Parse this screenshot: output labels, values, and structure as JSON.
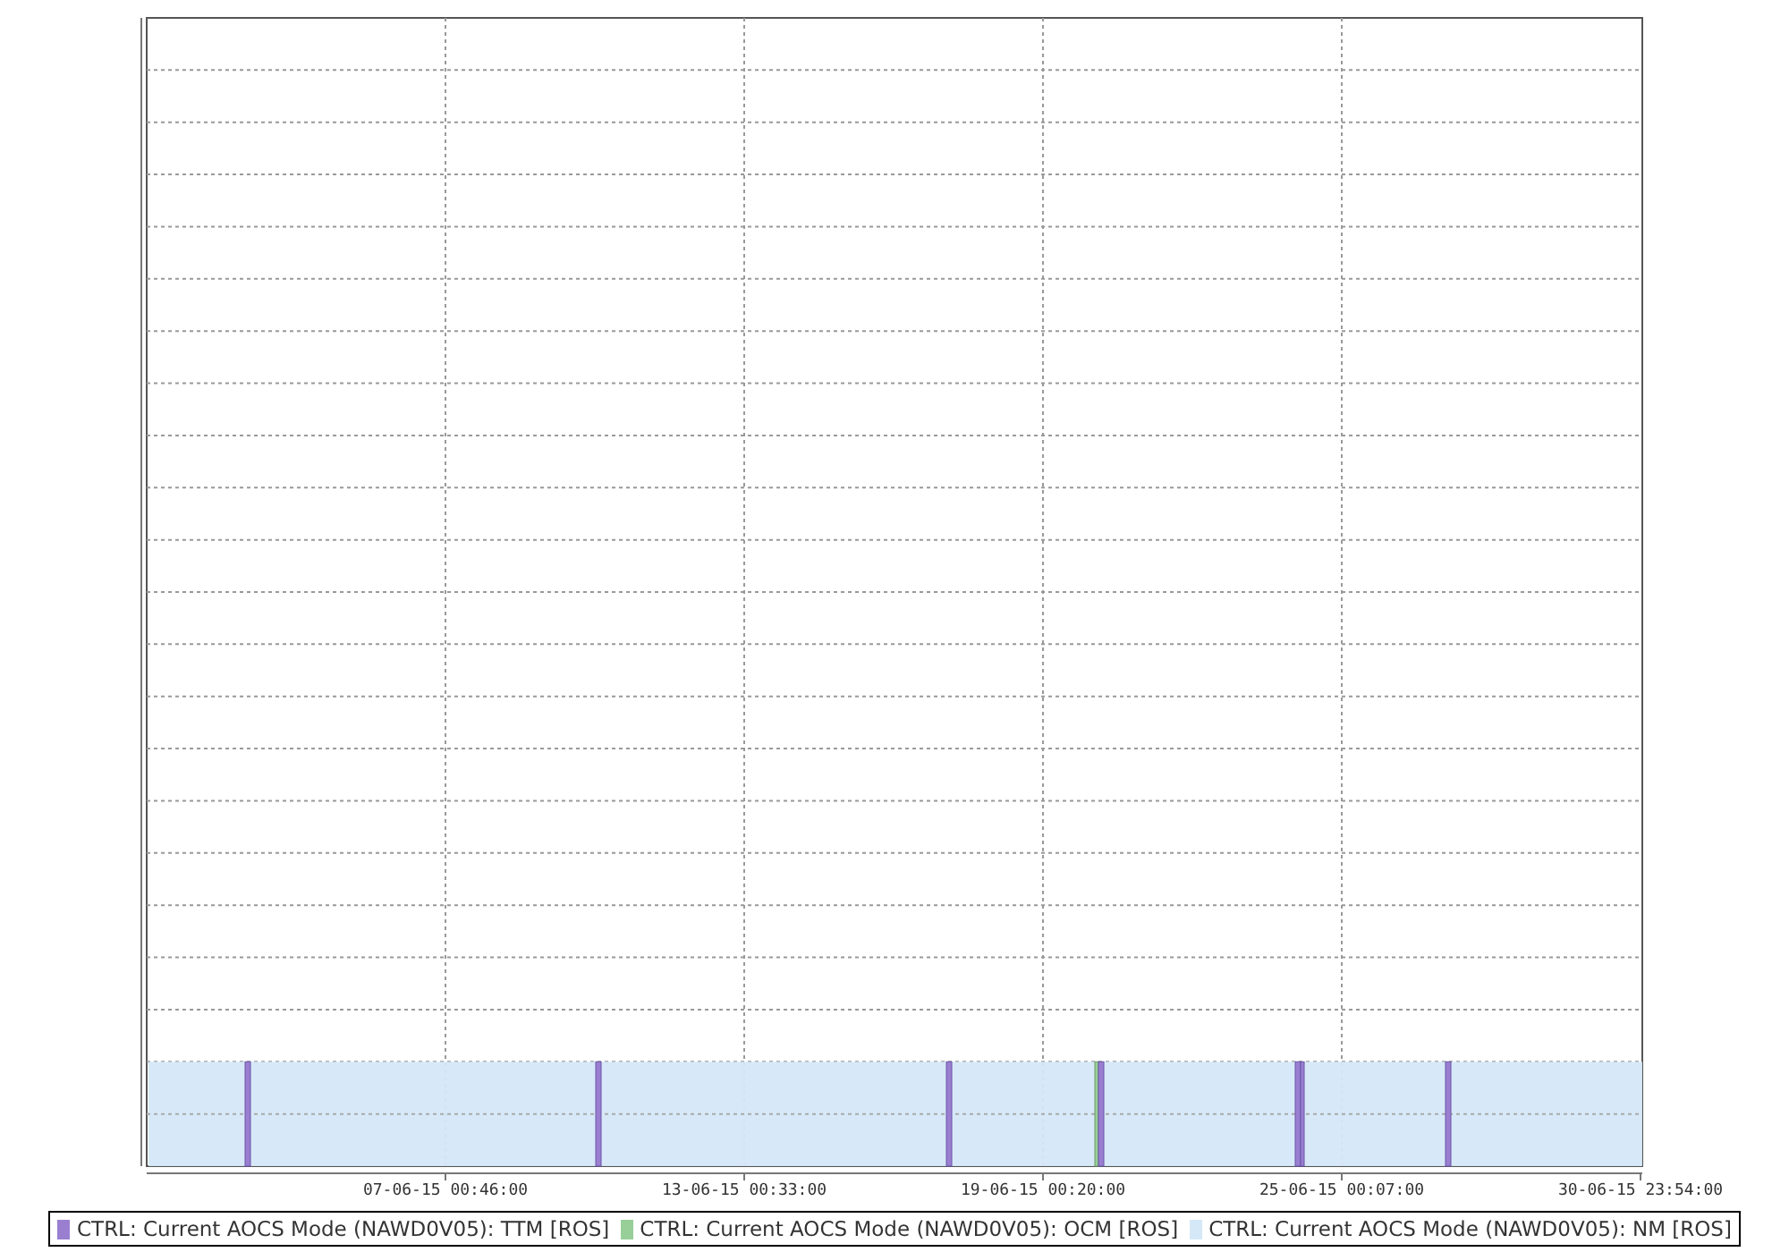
{
  "chart": {
    "x_tick_labels": [
      "07-06-15 00:46:00",
      "13-06-15 00:33:00",
      "19-06-15 00:20:00",
      "25-06-15 00:07:00",
      "30-06-15 23:54:00"
    ]
  },
  "legend": [
    {
      "label": "CTRL: Current AOCS Mode (NAWD0V05): TTM [ROS]",
      "color": "#9a7fd1"
    },
    {
      "label": "CTRL: Current AOCS Mode (NAWD0V05): OCM [ROS]",
      "color": "#98cf98"
    },
    {
      "label": "CTRL: Current AOCS Mode (NAWD0V05): NM [ROS]",
      "color": "#d5e8f8"
    }
  ]
}
